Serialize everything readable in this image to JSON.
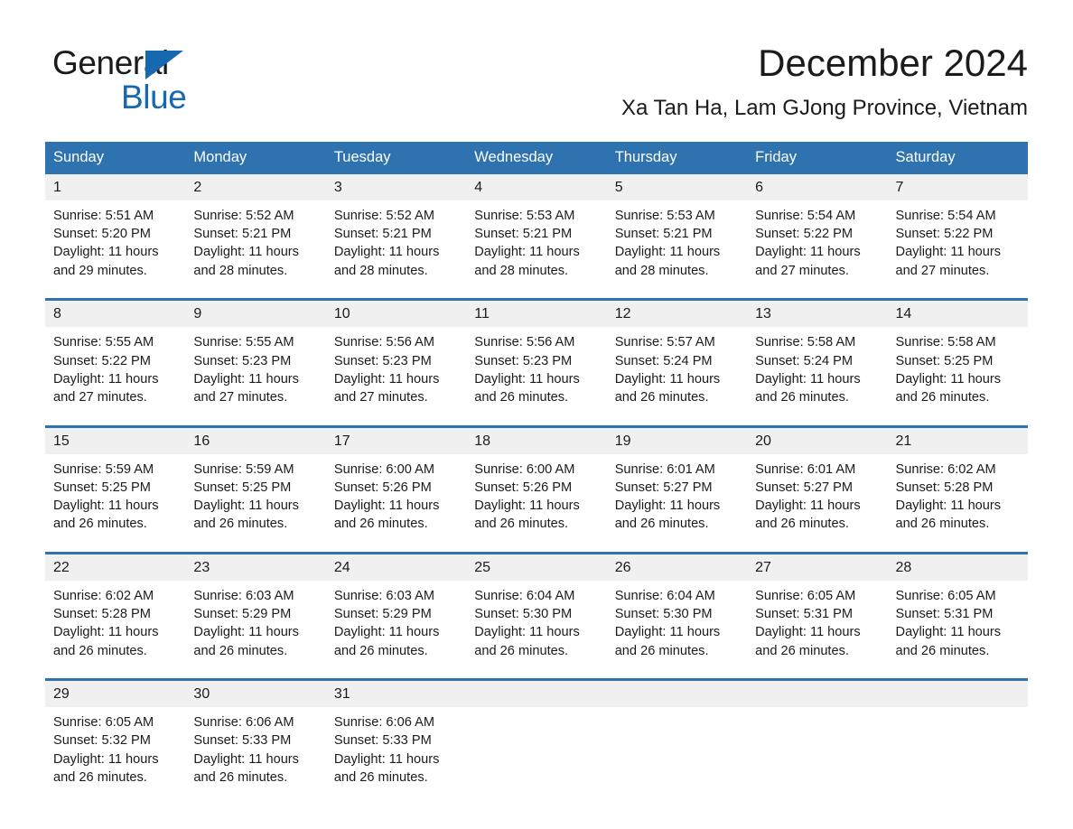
{
  "brand": {
    "name_part1": "General",
    "name_part2": "Blue",
    "triangle_icon": "triangle-icon",
    "accent_color": "#1668b0"
  },
  "header": {
    "title": "December 2024",
    "location": "Xa Tan Ha, Lam GJong Province, Vietnam"
  },
  "theme": {
    "header_blue": "#2e72b0",
    "daynum_band": "#f0f0f0",
    "text": "#1b1b1b"
  },
  "calendar": {
    "weekday_headers": [
      "Sunday",
      "Monday",
      "Tuesday",
      "Wednesday",
      "Thursday",
      "Friday",
      "Saturday"
    ],
    "weeks": [
      [
        {
          "day": "1",
          "sunrise": "Sunrise: 5:51 AM",
          "sunset": "Sunset: 5:20 PM",
          "daylight_line1": "Daylight: 11 hours",
          "daylight_line2": "and 29 minutes."
        },
        {
          "day": "2",
          "sunrise": "Sunrise: 5:52 AM",
          "sunset": "Sunset: 5:21 PM",
          "daylight_line1": "Daylight: 11 hours",
          "daylight_line2": "and 28 minutes."
        },
        {
          "day": "3",
          "sunrise": "Sunrise: 5:52 AM",
          "sunset": "Sunset: 5:21 PM",
          "daylight_line1": "Daylight: 11 hours",
          "daylight_line2": "and 28 minutes."
        },
        {
          "day": "4",
          "sunrise": "Sunrise: 5:53 AM",
          "sunset": "Sunset: 5:21 PM",
          "daylight_line1": "Daylight: 11 hours",
          "daylight_line2": "and 28 minutes."
        },
        {
          "day": "5",
          "sunrise": "Sunrise: 5:53 AM",
          "sunset": "Sunset: 5:21 PM",
          "daylight_line1": "Daylight: 11 hours",
          "daylight_line2": "and 28 minutes."
        },
        {
          "day": "6",
          "sunrise": "Sunrise: 5:54 AM",
          "sunset": "Sunset: 5:22 PM",
          "daylight_line1": "Daylight: 11 hours",
          "daylight_line2": "and 27 minutes."
        },
        {
          "day": "7",
          "sunrise": "Sunrise: 5:54 AM",
          "sunset": "Sunset: 5:22 PM",
          "daylight_line1": "Daylight: 11 hours",
          "daylight_line2": "and 27 minutes."
        }
      ],
      [
        {
          "day": "8",
          "sunrise": "Sunrise: 5:55 AM",
          "sunset": "Sunset: 5:22 PM",
          "daylight_line1": "Daylight: 11 hours",
          "daylight_line2": "and 27 minutes."
        },
        {
          "day": "9",
          "sunrise": "Sunrise: 5:55 AM",
          "sunset": "Sunset: 5:23 PM",
          "daylight_line1": "Daylight: 11 hours",
          "daylight_line2": "and 27 minutes."
        },
        {
          "day": "10",
          "sunrise": "Sunrise: 5:56 AM",
          "sunset": "Sunset: 5:23 PM",
          "daylight_line1": "Daylight: 11 hours",
          "daylight_line2": "and 27 minutes."
        },
        {
          "day": "11",
          "sunrise": "Sunrise: 5:56 AM",
          "sunset": "Sunset: 5:23 PM",
          "daylight_line1": "Daylight: 11 hours",
          "daylight_line2": "and 26 minutes."
        },
        {
          "day": "12",
          "sunrise": "Sunrise: 5:57 AM",
          "sunset": "Sunset: 5:24 PM",
          "daylight_line1": "Daylight: 11 hours",
          "daylight_line2": "and 26 minutes."
        },
        {
          "day": "13",
          "sunrise": "Sunrise: 5:58 AM",
          "sunset": "Sunset: 5:24 PM",
          "daylight_line1": "Daylight: 11 hours",
          "daylight_line2": "and 26 minutes."
        },
        {
          "day": "14",
          "sunrise": "Sunrise: 5:58 AM",
          "sunset": "Sunset: 5:25 PM",
          "daylight_line1": "Daylight: 11 hours",
          "daylight_line2": "and 26 minutes."
        }
      ],
      [
        {
          "day": "15",
          "sunrise": "Sunrise: 5:59 AM",
          "sunset": "Sunset: 5:25 PM",
          "daylight_line1": "Daylight: 11 hours",
          "daylight_line2": "and 26 minutes."
        },
        {
          "day": "16",
          "sunrise": "Sunrise: 5:59 AM",
          "sunset": "Sunset: 5:25 PM",
          "daylight_line1": "Daylight: 11 hours",
          "daylight_line2": "and 26 minutes."
        },
        {
          "day": "17",
          "sunrise": "Sunrise: 6:00 AM",
          "sunset": "Sunset: 5:26 PM",
          "daylight_line1": "Daylight: 11 hours",
          "daylight_line2": "and 26 minutes."
        },
        {
          "day": "18",
          "sunrise": "Sunrise: 6:00 AM",
          "sunset": "Sunset: 5:26 PM",
          "daylight_line1": "Daylight: 11 hours",
          "daylight_line2": "and 26 minutes."
        },
        {
          "day": "19",
          "sunrise": "Sunrise: 6:01 AM",
          "sunset": "Sunset: 5:27 PM",
          "daylight_line1": "Daylight: 11 hours",
          "daylight_line2": "and 26 minutes."
        },
        {
          "day": "20",
          "sunrise": "Sunrise: 6:01 AM",
          "sunset": "Sunset: 5:27 PM",
          "daylight_line1": "Daylight: 11 hours",
          "daylight_line2": "and 26 minutes."
        },
        {
          "day": "21",
          "sunrise": "Sunrise: 6:02 AM",
          "sunset": "Sunset: 5:28 PM",
          "daylight_line1": "Daylight: 11 hours",
          "daylight_line2": "and 26 minutes."
        }
      ],
      [
        {
          "day": "22",
          "sunrise": "Sunrise: 6:02 AM",
          "sunset": "Sunset: 5:28 PM",
          "daylight_line1": "Daylight: 11 hours",
          "daylight_line2": "and 26 minutes."
        },
        {
          "day": "23",
          "sunrise": "Sunrise: 6:03 AM",
          "sunset": "Sunset: 5:29 PM",
          "daylight_line1": "Daylight: 11 hours",
          "daylight_line2": "and 26 minutes."
        },
        {
          "day": "24",
          "sunrise": "Sunrise: 6:03 AM",
          "sunset": "Sunset: 5:29 PM",
          "daylight_line1": "Daylight: 11 hours",
          "daylight_line2": "and 26 minutes."
        },
        {
          "day": "25",
          "sunrise": "Sunrise: 6:04 AM",
          "sunset": "Sunset: 5:30 PM",
          "daylight_line1": "Daylight: 11 hours",
          "daylight_line2": "and 26 minutes."
        },
        {
          "day": "26",
          "sunrise": "Sunrise: 6:04 AM",
          "sunset": "Sunset: 5:30 PM",
          "daylight_line1": "Daylight: 11 hours",
          "daylight_line2": "and 26 minutes."
        },
        {
          "day": "27",
          "sunrise": "Sunrise: 6:05 AM",
          "sunset": "Sunset: 5:31 PM",
          "daylight_line1": "Daylight: 11 hours",
          "daylight_line2": "and 26 minutes."
        },
        {
          "day": "28",
          "sunrise": "Sunrise: 6:05 AM",
          "sunset": "Sunset: 5:31 PM",
          "daylight_line1": "Daylight: 11 hours",
          "daylight_line2": "and 26 minutes."
        }
      ],
      [
        {
          "day": "29",
          "sunrise": "Sunrise: 6:05 AM",
          "sunset": "Sunset: 5:32 PM",
          "daylight_line1": "Daylight: 11 hours",
          "daylight_line2": "and 26 minutes."
        },
        {
          "day": "30",
          "sunrise": "Sunrise: 6:06 AM",
          "sunset": "Sunset: 5:33 PM",
          "daylight_line1": "Daylight: 11 hours",
          "daylight_line2": "and 26 minutes."
        },
        {
          "day": "31",
          "sunrise": "Sunrise: 6:06 AM",
          "sunset": "Sunset: 5:33 PM",
          "daylight_line1": "Daylight: 11 hours",
          "daylight_line2": "and 26 minutes."
        },
        {
          "day": "",
          "sunrise": "",
          "sunset": "",
          "daylight_line1": "",
          "daylight_line2": ""
        },
        {
          "day": "",
          "sunrise": "",
          "sunset": "",
          "daylight_line1": "",
          "daylight_line2": ""
        },
        {
          "day": "",
          "sunrise": "",
          "sunset": "",
          "daylight_line1": "",
          "daylight_line2": ""
        },
        {
          "day": "",
          "sunrise": "",
          "sunset": "",
          "daylight_line1": "",
          "daylight_line2": ""
        }
      ]
    ]
  }
}
